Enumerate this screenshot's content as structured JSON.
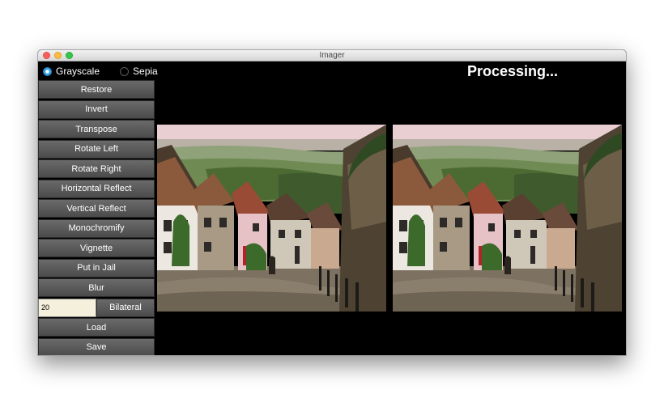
{
  "window": {
    "title": "Imager"
  },
  "filters": {
    "grayscale_label": "Grayscale",
    "sepia_label": "Sepia",
    "selected": "Grayscale"
  },
  "buttons": {
    "restore": "Restore",
    "invert": "Invert",
    "transpose": "Transpose",
    "rotate_left": "Rotate Left",
    "rotate_right": "Rotate Right",
    "horizontal_reflect": "Horizontal Reflect",
    "vertical_reflect": "Vertical Reflect",
    "monochromify": "Monochromify",
    "vignette": "Vignette",
    "put_in_jail": "Put in Jail",
    "blur": "Blur",
    "bilateral": "Bilateral",
    "load": "Load",
    "save": "Save"
  },
  "bilateral_input": {
    "value": "20"
  },
  "status": {
    "text": "Processing..."
  },
  "colors": {
    "sky": "#e9cfd2",
    "hills": "#6f8a52",
    "foliage": "#3f5a2c",
    "road": "#8a7f6d",
    "roof_brown": "#8b5a3c",
    "house_white": "#ece7e0",
    "house_pink": "#e6c2c6",
    "stone": "#4e4232"
  }
}
